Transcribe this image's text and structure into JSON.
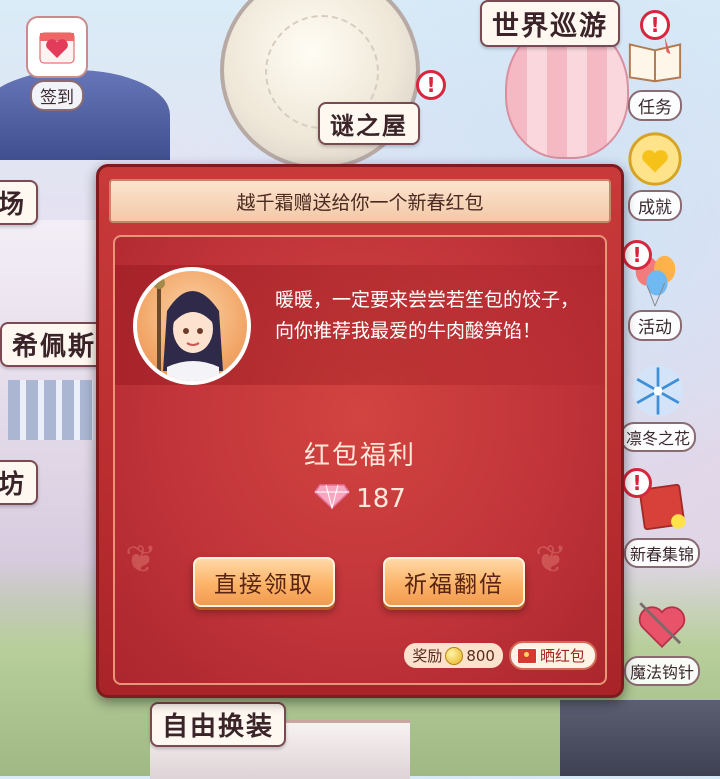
{
  "scene": {
    "left_tags": [
      "坊",
      "希佩斯",
      "场"
    ],
    "top_tag": "谜之屋",
    "world_tag": "世界巡游",
    "bottom_tag": "自由换装"
  },
  "side_buttons": {
    "checkin": {
      "label": "签到",
      "icon": "heart-calendar-icon"
    },
    "tasks": {
      "label": "任务",
      "icon": "book-icon"
    },
    "achievement": {
      "label": "成就",
      "icon": "heart-medal-icon"
    },
    "activity": {
      "label": "活动",
      "icon": "balloon-icon"
    },
    "winter_flower": {
      "label": "凛冬之花",
      "icon": "snowflake-icon"
    },
    "spring_collection": {
      "label": "新春集锦",
      "icon": "spring-card-icon"
    },
    "magic_crochet": {
      "label": "魔法钩针",
      "icon": "yarn-heart-icon"
    }
  },
  "alerts": {
    "mark": "!"
  },
  "modal": {
    "header": "越千霜赠送给你一个新春红包",
    "message": "暖暖，一定要来尝尝若笙包的饺子，向你推荐我最爱的牛肉酸笋馅！",
    "reward_title": "红包福利",
    "reward_amount": "187",
    "buttons": {
      "direct": "直接领取",
      "blessing": "祈福翻倍"
    },
    "footer": {
      "bonus_label": "奖励",
      "bonus_value": "800",
      "share_label": "晒红包"
    }
  },
  "colors": {
    "modal_red": "#b92d30",
    "header_peach": "#f3c9a7",
    "button_orange": "#fbb368"
  }
}
